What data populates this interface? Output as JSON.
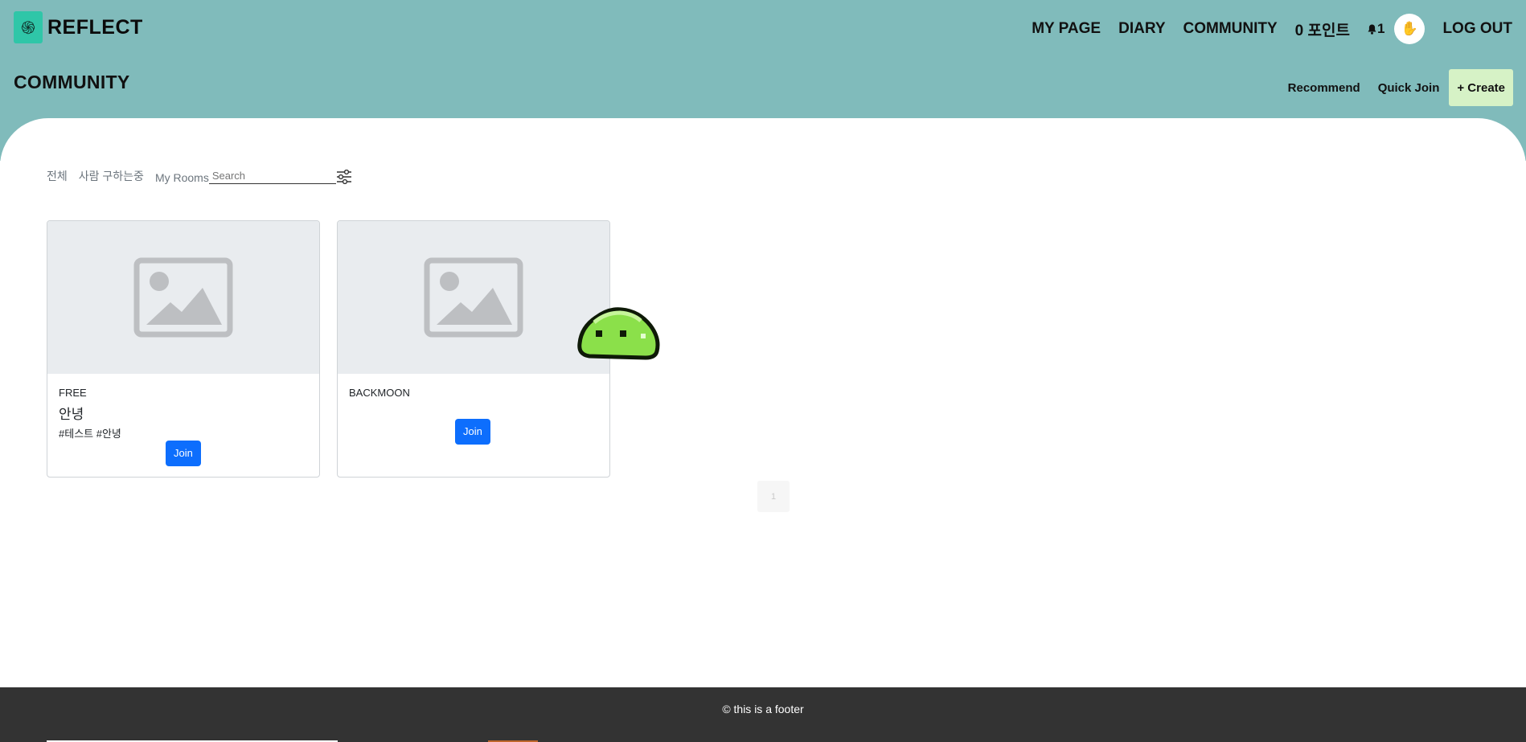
{
  "brand": {
    "name": "REFLECT",
    "logo_icon": "reflect-logo-icon"
  },
  "topnav": {
    "mypage": "MY PAGE",
    "diary": "DIARY",
    "community": "COMMUNITY",
    "points": "0 포인트",
    "notifications": "1",
    "avatar_emoji": "✋",
    "logout": "LOG OUT"
  },
  "page": {
    "title": "COMMUNITY"
  },
  "subnav": {
    "recommend": "Recommend",
    "quick_join": "Quick Join",
    "create": "+ Create"
  },
  "filters": {
    "all": "전체",
    "recruiting": "사람 구하는중",
    "my_rooms": "My Rooms",
    "search_placeholder": "Search"
  },
  "rooms": [
    {
      "category": "FREE",
      "name": "안녕",
      "tags": "#테스트 #안녕",
      "join_label": "Join"
    },
    {
      "category": "BACKMOON",
      "name": "",
      "tags": "",
      "join_label": "Join"
    }
  ],
  "pagination": {
    "current": "1"
  },
  "footer": {
    "text": "© this is a footer"
  },
  "colors": {
    "header": "#80bbbb",
    "accent": "#0d6efd",
    "create_bg": "#d6f2c6",
    "footer": "#333333"
  }
}
